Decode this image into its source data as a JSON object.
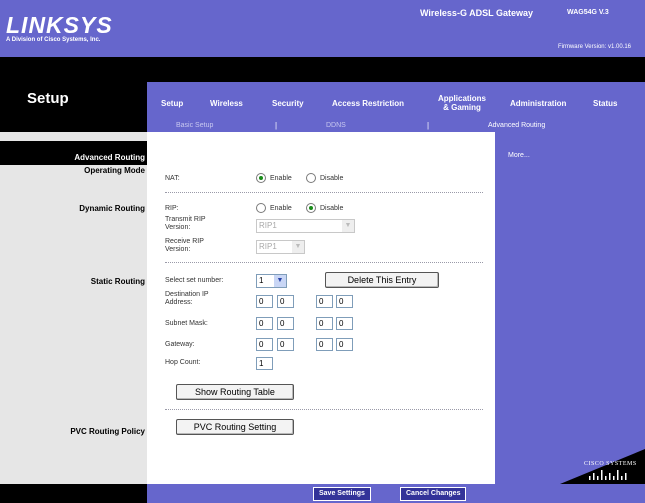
{
  "brand": {
    "logo": "LINKSYS",
    "tagline": "A Division of Cisco Systems, Inc.",
    "firmware": "Firmware Version: v1.00.16"
  },
  "product": {
    "name": "Wireless-G ADSL Gateway",
    "model": "WAG54G V.3"
  },
  "section": "Setup",
  "tabs": [
    {
      "label": "Setup"
    },
    {
      "label": "Wireless"
    },
    {
      "label": "Security"
    },
    {
      "label": "Access Restriction"
    },
    {
      "label": "Applications & Gaming",
      "line1": "Applications",
      "line2": "& Gaming"
    },
    {
      "label": "Administration"
    },
    {
      "label": "Status"
    }
  ],
  "subtabs": [
    {
      "label": "Basic Setup"
    },
    {
      "label": "DDNS"
    },
    {
      "label": "Advanced Routing"
    }
  ],
  "sidebar": {
    "header": "Advanced Routing",
    "operating_mode": "Operating Mode",
    "dynamic_routing": "Dynamic Routing",
    "static_routing": "Static Routing",
    "pvc_routing_policy": "PVC Routing Policy"
  },
  "form": {
    "nat_label": "NAT:",
    "nat_enable": "Enable",
    "nat_disable": "Disable",
    "nat_value": "Enable",
    "rip_label": "RIP:",
    "rip_enable": "Enable",
    "rip_disable": "Disable",
    "rip_value": "Disable",
    "transmit_rip_label": "Transmit RIP Version:",
    "transmit_rip_value": "RIP1",
    "receive_rip_label": "Receive RIP Version:",
    "receive_rip_value": "RIP1",
    "select_set_label": "Select set number:",
    "select_set_value": "1",
    "delete_entry": "Delete This Entry",
    "dest_ip_label": "Destination IP Address:",
    "dest_ip": [
      "0",
      "0",
      "0",
      "0"
    ],
    "subnet_label": "Subnet Mask:",
    "subnet": [
      "0",
      "0",
      "0",
      "0"
    ],
    "gateway_label": "Gateway:",
    "gateway": [
      "0",
      "0",
      "0",
      "0"
    ],
    "hop_label": "Hop Count:",
    "hop_value": "1",
    "show_routing_table": "Show Routing Table",
    "pvc_routing_setting": "PVC Routing Setting"
  },
  "help": {
    "more": "More..."
  },
  "footer": {
    "save": "Save Settings",
    "cancel": "Cancel Changes",
    "cisco": "CISCO SYSTEMS"
  },
  "colors": {
    "accent": "#6666cc",
    "dark": "#000000",
    "footer_button": "#333399"
  }
}
